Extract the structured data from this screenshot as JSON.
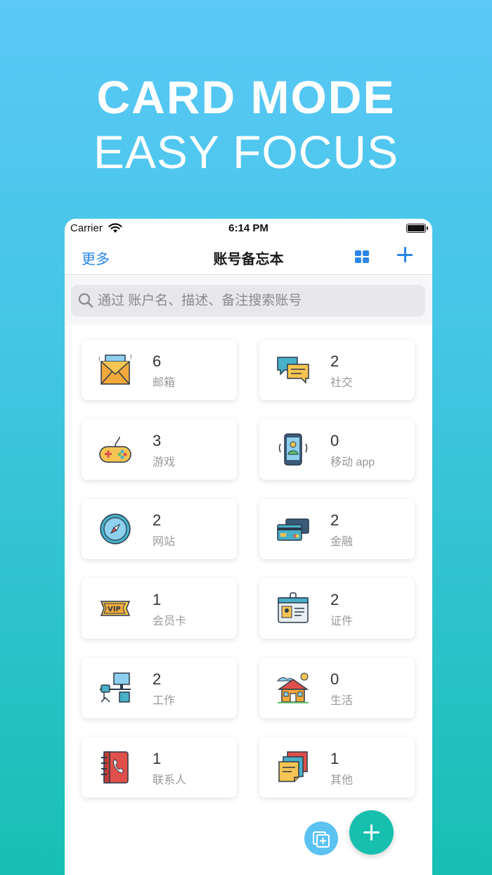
{
  "hero": {
    "title": "CARD MODE",
    "subtitle": "EASY FOCUS"
  },
  "status": {
    "carrier": "Carrier",
    "time": "6:14 PM"
  },
  "nav": {
    "more": "更多",
    "title": "账号备忘本"
  },
  "search": {
    "placeholder": "通过 账户名、描述、备注搜索账号"
  },
  "categories": [
    {
      "count": "6",
      "label": "邮箱",
      "icon": "mail-icon"
    },
    {
      "count": "2",
      "label": "社交",
      "icon": "chat-icon"
    },
    {
      "count": "3",
      "label": "游戏",
      "icon": "gamepad-icon"
    },
    {
      "count": "0",
      "label": "移动 app",
      "icon": "mobile-icon"
    },
    {
      "count": "2",
      "label": "网站",
      "icon": "compass-icon"
    },
    {
      "count": "2",
      "label": "金融",
      "icon": "credit-card-icon"
    },
    {
      "count": "1",
      "label": "会员卡",
      "icon": "vip-ticket-icon"
    },
    {
      "count": "2",
      "label": "证件",
      "icon": "id-card-icon"
    },
    {
      "count": "2",
      "label": "工作",
      "icon": "workstation-icon"
    },
    {
      "count": "0",
      "label": "生活",
      "icon": "house-icon"
    },
    {
      "count": "1",
      "label": "联系人",
      "icon": "contact-book-icon"
    },
    {
      "count": "1",
      "label": "其他",
      "icon": "notes-icon"
    }
  ],
  "colors": {
    "accent": "#2a86e6",
    "fab": "#17bfae",
    "fab_secondary": "#5cc2f2"
  }
}
